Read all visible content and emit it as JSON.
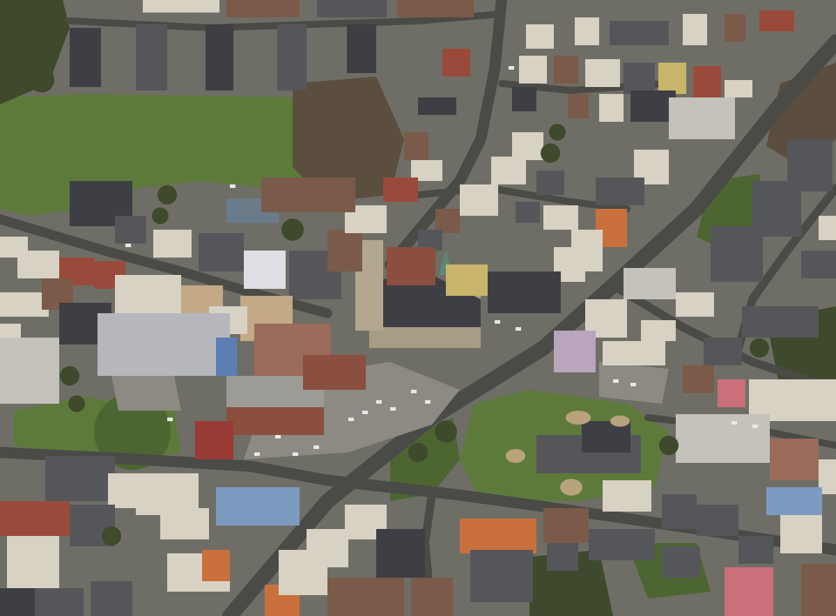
{
  "image": {
    "kind": "aerial-photograph",
    "subject": "town-centre",
    "palette": {
      "ground": "#6f6e66",
      "road": "#4a4a47",
      "pavement": "#8c8a83",
      "grass": "#5d7a3a",
      "dark_grass": "#4c6531",
      "tree": "#3f4a2c",
      "bare_tree": "#5b4e3f",
      "roof_grey": "#55565a",
      "roof_dark": "#3e3f45",
      "roof_red": "#9a4a3a",
      "roof_orange": "#c9703c",
      "roof_brown": "#7a5a48",
      "wall_light": "#d8d2c4",
      "wall_brick": "#8a4f3f",
      "church_stone": "#a79d86",
      "car": "#e8e8e8",
      "pitch_sand": "#b9a37c"
    }
  }
}
